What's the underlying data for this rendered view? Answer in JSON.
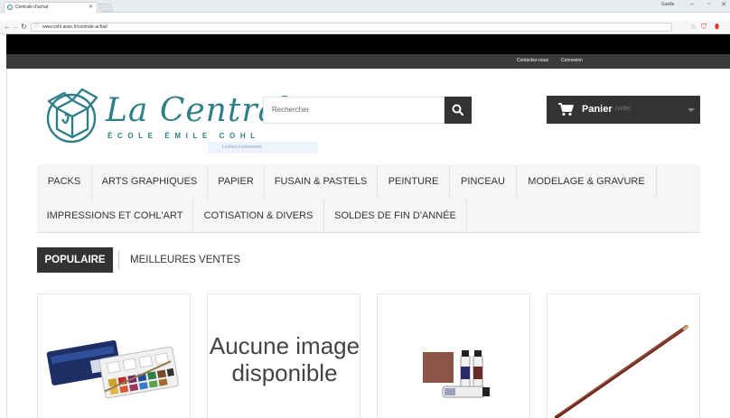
{
  "browser": {
    "tab_title": "Centrale d'achat",
    "url": "www.cohl.asso.fr/centrale-achat/",
    "user_name": "Gaelle"
  },
  "topbar": {
    "contact_label": "Contactez-nous",
    "login_label": "Connexion"
  },
  "logo": {
    "name": "La Centrale",
    "subtitle": "ÉCOLE ÉMILE COHL"
  },
  "search": {
    "placeholder": "Rechercher",
    "hint": "Lecture instantanée"
  },
  "cart": {
    "label": "Panier",
    "status": "(vide)"
  },
  "menu": {
    "items": [
      "PACKS",
      "ARTS GRAPHIQUES",
      "PAPIER",
      "FUSAIN & PASTELS",
      "PEINTURE",
      "PINCEAU",
      "MODELAGE & GRAVURE",
      "IMPRESSIONS ET COHL'ART",
      "COTISATION & DIVERS",
      "SOLDES DE FIN D'ANNÉE"
    ]
  },
  "tabs": {
    "popular": "POPULAIRE",
    "best_sellers": "MEILLEURES VENTES"
  },
  "products": {
    "no_image_text": "Aucune image disponible"
  },
  "colors": {
    "brand": "#2f7f86",
    "dark": "#333333"
  }
}
